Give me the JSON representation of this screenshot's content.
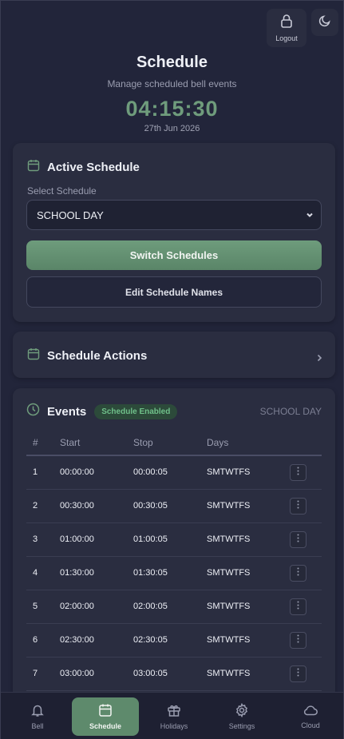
{
  "topbar": {
    "logout_label": "Logout"
  },
  "header": {
    "title": "Schedule",
    "subtitle": "Manage scheduled bell events",
    "clock": "04:15:30",
    "date": "27th Jun 2026"
  },
  "active_schedule": {
    "title": "Active Schedule",
    "select_label": "Select Schedule",
    "selected": "SCHOOL DAY",
    "switch_label": "Switch Schedules",
    "edit_label": "Edit Schedule Names"
  },
  "schedule_actions": {
    "title": "Schedule Actions"
  },
  "events": {
    "title": "Events",
    "badge": "Schedule Enabled",
    "schedule_name": "SCHOOL DAY",
    "columns": [
      "#",
      "Start",
      "Stop",
      "Days"
    ],
    "rows": [
      {
        "num": "1",
        "start": "00:00:00",
        "stop": "00:00:05",
        "days": "SMTWTFS"
      },
      {
        "num": "2",
        "start": "00:30:00",
        "stop": "00:30:05",
        "days": "SMTWTFS"
      },
      {
        "num": "3",
        "start": "01:00:00",
        "stop": "01:00:05",
        "days": "SMTWTFS"
      },
      {
        "num": "4",
        "start": "01:30:00",
        "stop": "01:30:05",
        "days": "SMTWTFS"
      },
      {
        "num": "5",
        "start": "02:00:00",
        "stop": "02:00:05",
        "days": "SMTWTFS"
      },
      {
        "num": "6",
        "start": "02:30:00",
        "stop": "02:30:05",
        "days": "SMTWTFS"
      },
      {
        "num": "7",
        "start": "03:00:00",
        "stop": "03:00:05",
        "days": "SMTWTFS"
      }
    ]
  },
  "nav": {
    "bell": "Bell",
    "schedule": "Schedule",
    "holidays": "Holidays",
    "settings": "Settings",
    "cloud": "Cloud"
  },
  "colors": {
    "accent": "#5e8a6c",
    "clock": "#6f9c7c",
    "badge_text": "#6fc08a"
  }
}
